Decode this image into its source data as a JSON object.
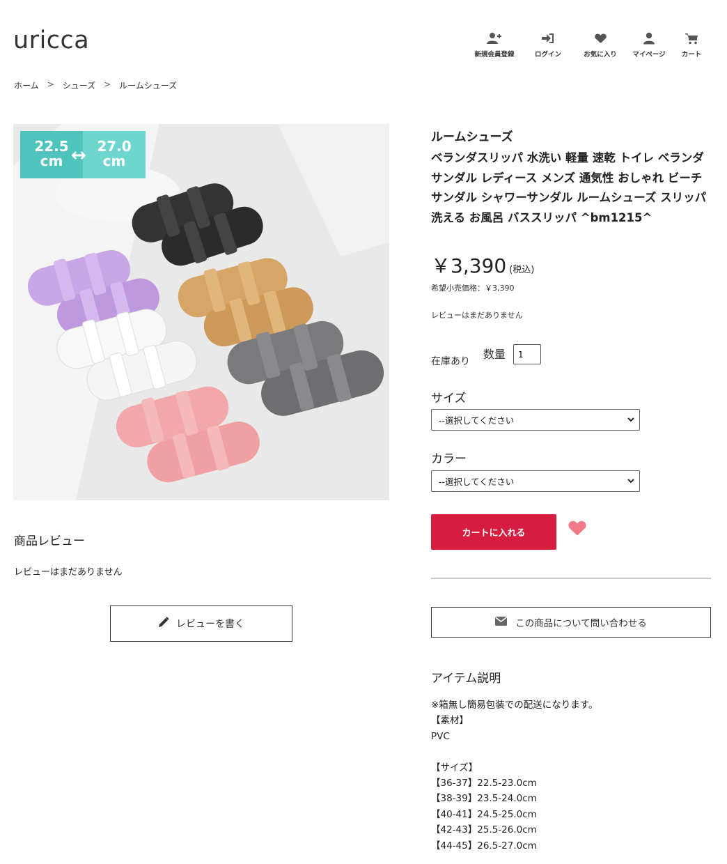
{
  "header": {
    "logo": "uricca",
    "nav": [
      {
        "label": "新規会員登録",
        "icon": "user-plus-icon"
      },
      {
        "label": "ログイン",
        "icon": "sign-in-icon"
      },
      {
        "label": "お気に入り",
        "icon": "heart-icon"
      },
      {
        "label": "マイページ",
        "icon": "user-icon"
      },
      {
        "label": "カート",
        "icon": "cart-icon"
      }
    ]
  },
  "breadcrumb": {
    "items": [
      "ホーム",
      "シューズ",
      "ルームシューズ"
    ],
    "separator": ">"
  },
  "image": {
    "badge_left": "22.5\ncm",
    "badge_left_num": "22.5",
    "badge_right_num": "27.0",
    "badge_unit": "cm",
    "alt": "product-photo"
  },
  "reviews": {
    "title": "商品レビュー",
    "empty_text": "レビューはまだありません",
    "write_button": "レビューを書く"
  },
  "product": {
    "category": "ルームシューズ",
    "title": "ベランダスリッパ 水洗い 軽量 速乾 トイレ ベランダサンダル レディース メンズ 通気性 おしゃれ ビーチサンダル シャワーサンダル ルームシューズ スリッパ 洗える お風呂 バススリッパ ^bm1215^",
    "price": "￥3,390",
    "tax_note": "(税込)",
    "msrp": "希望小売価格：￥3,390",
    "review_status": "レビューはまだありません",
    "stock": "在庫あり",
    "qty_label": "数量",
    "qty_value": "1",
    "size_label": "サイズ",
    "size_selected": "--選択してください",
    "color_label": "カラー",
    "color_selected": "--選択してください",
    "cart_button": "カートに入れる",
    "inquiry_button": "この商品について問い合わせる"
  },
  "description": {
    "title": "アイテム説明",
    "lines": [
      "※箱無し簡易包装での配送になります。",
      "【素材】",
      "PVC",
      "",
      "【サイズ】",
      "【36-37】22.5-23.0cm",
      "【38-39】23.5-24.0cm",
      "【40-41】24.5-25.0cm",
      "【42-43】25.5-26.0cm",
      "【44-45】26.5-27.0cm"
    ]
  },
  "colors": {
    "accent": "#d61d3f",
    "heart": "#f07a85",
    "badge": "#4fc4bd"
  }
}
